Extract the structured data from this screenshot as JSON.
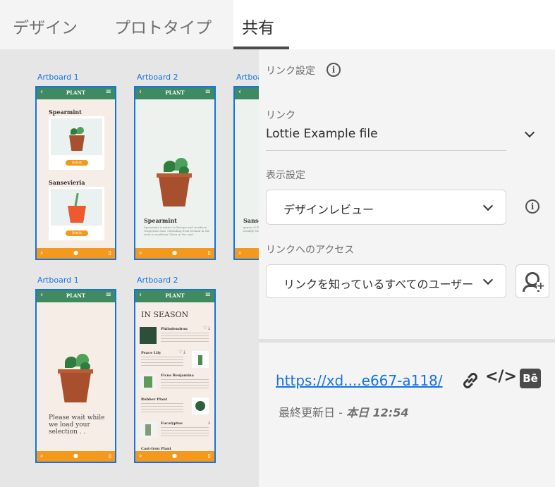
{
  "tabs": [
    {
      "label": "デザイン",
      "active": false
    },
    {
      "label": "プロトタイプ",
      "active": false
    },
    {
      "label": "共有",
      "active": true
    }
  ],
  "canvas": {
    "artboards": [
      {
        "label": "Artboard 1",
        "app_title": "PLANT",
        "items": [
          {
            "title": "Spearmint",
            "button": "Details"
          },
          {
            "title": "Sansevieria",
            "button": "Details"
          }
        ]
      },
      {
        "label": "Artboard 2",
        "app_title": "PLANT",
        "title": "Spearmint",
        "body": "Spearmint is native to Europe and southern temperate Asia, extending from Ireland in the west to southern China in the east."
      },
      {
        "label": "Artboard",
        "app_title": "PLANT",
        "title": "Sanse",
        "body": "genus of Flo notably Mo"
      },
      {
        "label": "Artboard 1",
        "app_title": "PLANT",
        "loading": "Please wait while we load your selection . ."
      },
      {
        "label": "Artboard 2",
        "app_title": "PLANT",
        "heading": "IN SEASON",
        "list": [
          "Philodendron",
          "Peace Lily",
          "Ficus Benjamina",
          "Rubber Plant",
          "Eucalyptus",
          "Cast-Iron Plant"
        ]
      }
    ]
  },
  "panel": {
    "section_title": "リンク設定",
    "link_label": "リンク",
    "link_value": "Lottie Example file",
    "view_label": "表示設定",
    "view_value": "デザインレビュー",
    "access_label": "リンクへのアクセス",
    "access_value": "リンクを知っているすべてのユーザー",
    "share_url": "https://xd....e667-a118/",
    "behance_label": "Bē",
    "updated_prefix": "最終更新日 - ",
    "updated_value": "本日 12:54"
  },
  "colors": {
    "accent": "#1473e6",
    "plant_green": "#3f8a60",
    "plant_orange": "#f39a1e"
  },
  "icons": [
    "info-icon",
    "chevron-down-icon",
    "add-user-icon",
    "link-icon",
    "embed-code-icon",
    "behance-icon",
    "back-arrow-icon",
    "hamburger-menu-icon",
    "search-icon",
    "microphone-icon",
    "bookmark-icon",
    "heart-icon",
    "download-icon"
  ]
}
